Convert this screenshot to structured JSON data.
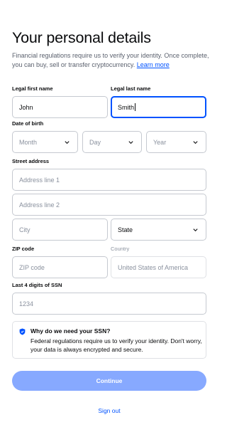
{
  "header": {
    "title": "Your personal details",
    "subtitle": "Financial regulations require us to verify your identity. Once complete, you can buy, sell or transfer cryptocurrency.",
    "learn_more": "Learn more"
  },
  "form": {
    "first_name": {
      "label": "Legal first name",
      "value": "John"
    },
    "last_name": {
      "label": "Legal last name",
      "value": "Smith"
    },
    "dob": {
      "label": "Date of birth",
      "month": "Month",
      "day": "Day",
      "year": "Year"
    },
    "address": {
      "label": "Street address",
      "line1_placeholder": "Address line 1",
      "line2_placeholder": "Address line 2",
      "city_placeholder": "City",
      "state": "State"
    },
    "zip": {
      "label": "ZIP code",
      "placeholder": "ZIP code"
    },
    "country": {
      "label": "Country",
      "value": "United States of America"
    },
    "ssn": {
      "label": "Last 4 digits of SSN",
      "placeholder": "1234"
    }
  },
  "info": {
    "icon": "shield-icon",
    "heading": "Why do we need your SSN?",
    "body": "Federal regulations require us to verify your identity. Don't worry, your data is always encrypted and secure."
  },
  "actions": {
    "continue": "Continue",
    "sign_out": "Sign out"
  },
  "colors": {
    "accent": "#0052ff",
    "button_disabled": "#87a9ff",
    "border": "#c5c9d0"
  }
}
